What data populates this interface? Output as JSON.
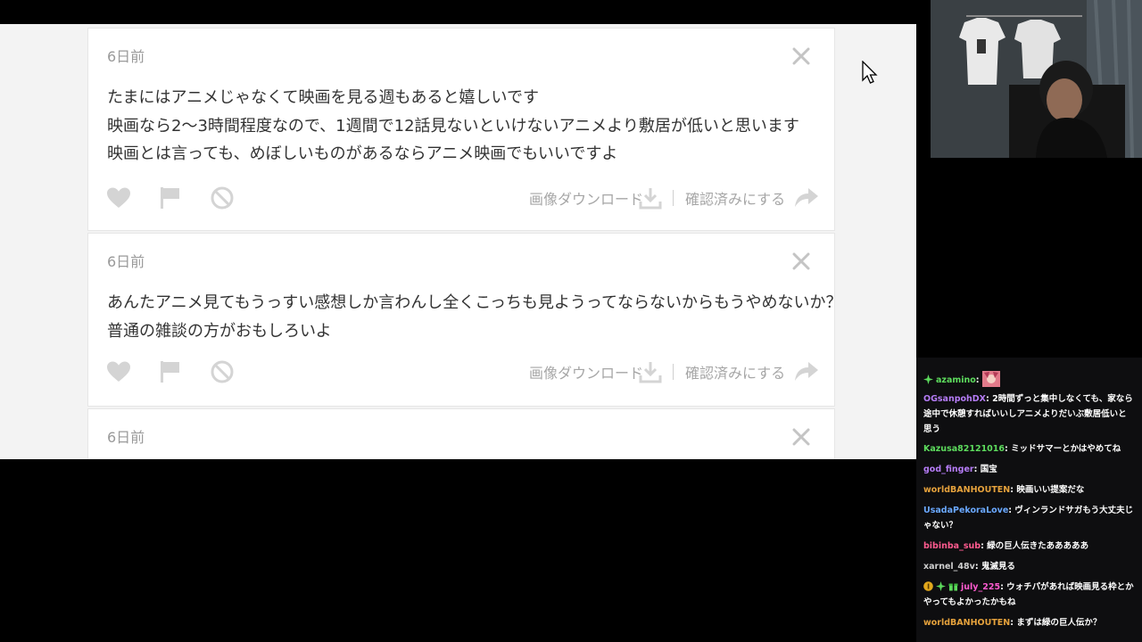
{
  "panel": {
    "cards": [
      {
        "date": "6日前",
        "lines": [
          "たまにはアニメじゃなくて映画を見る週もあると嬉しいです",
          "映画なら2〜3時間程度なので、1週間で12話見ないといけないアニメより敷居が低いと思います",
          "映画とは言っても、めぼしいものがあるならアニメ映画でもいいですよ"
        ],
        "download_label": "画像ダウンロード",
        "mark_label": "確認済みにする"
      },
      {
        "date": "6日前",
        "lines": [
          "あんたアニメ見てもうっすい感想しか言わんし全くこっちも見ようってならないからもうやめないか？",
          "普通の雑談の方がおもしろいよ"
        ],
        "download_label": "画像ダウンロード",
        "mark_label": "確認済みにする"
      },
      {
        "date": "6日前",
        "lines": []
      }
    ]
  },
  "chat": {
    "messages": [
      {
        "user": "azamino",
        "color": "#5ddc5d",
        "text": ""
      },
      {
        "user": "OGsanpohDX",
        "color": "#b57cf6",
        "text": "2時間ずっと集中しなくても、家なら途中で休憩すればいいしアニメよりだいぶ敷居低いと思う"
      },
      {
        "user": "Kazusa82121016",
        "color": "#5ddc5d",
        "text": "ミッドサマーとかはやめてね"
      },
      {
        "user": "god_finger",
        "color": "#b57cf6",
        "text": "国宝"
      },
      {
        "user": "worldBANHOUTEN",
        "color": "#e6a23c",
        "text": "映画いい提案だな"
      },
      {
        "user": "UsadaPekoraLove",
        "color": "#6aa8ff",
        "text": "ヴィンランドサガもう大丈夫じゃない？"
      },
      {
        "user": "bibinba_sub",
        "color": "#ff5b8f",
        "text": "緑の巨人伝きたあああああ"
      },
      {
        "user": "xarnel_48v",
        "color": "#cfcfcf",
        "text": "鬼滅見る"
      },
      {
        "user": "july_225",
        "color": "#ff5bd0",
        "text": "ウォチパがあれば映画見る枠とかやってもよかったかもね"
      },
      {
        "user": "worldBANHOUTEN",
        "color": "#e6a23c",
        "text": "まずは緑の巨人伝か？"
      }
    ]
  },
  "colors": {
    "panel_bg": "#f3f3f3",
    "card_bg": "#ffffff",
    "chat_bg": "#0e0e10",
    "icon_gray": "#d4d4d4"
  }
}
